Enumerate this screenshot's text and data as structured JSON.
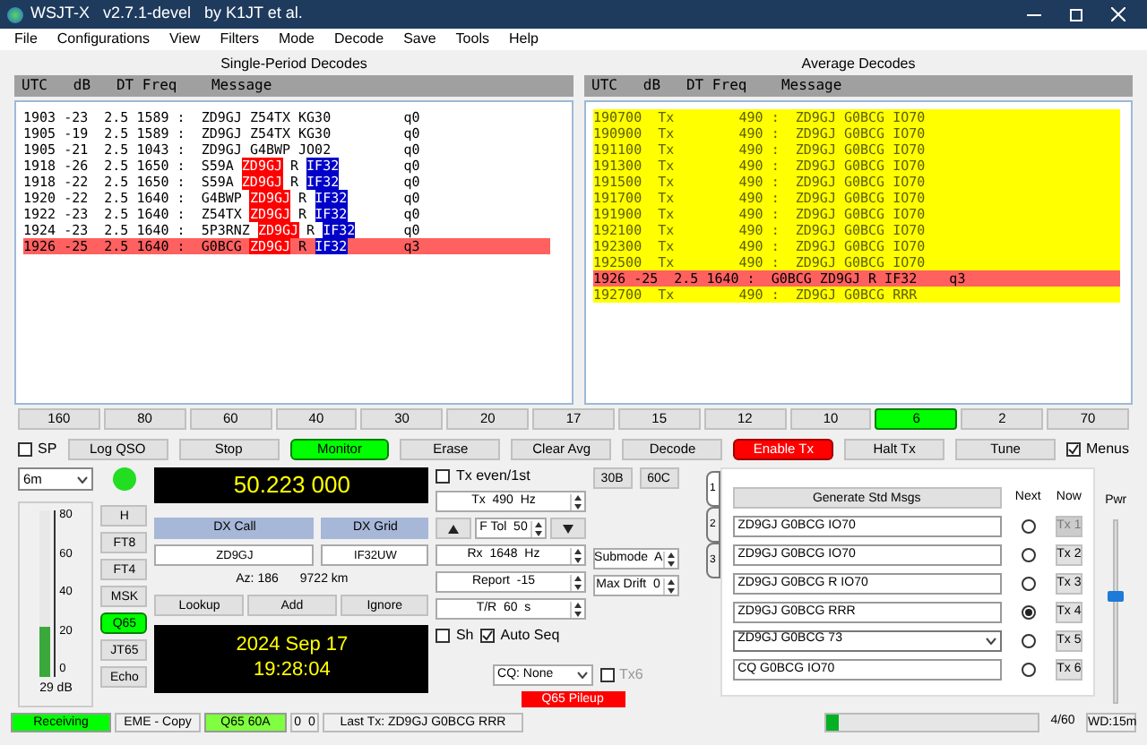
{
  "window": {
    "title": "WSJT-X   v2.7.1-devel   by K1JT et al."
  },
  "menu": [
    "File",
    "Configurations",
    "View",
    "Filters",
    "Mode",
    "Decode",
    "Save",
    "Tools",
    "Help"
  ],
  "single_period": {
    "title": "Single-Period Decodes",
    "header": "UTC   dB   DT Freq    Message",
    "rows": [
      {
        "utc": "1903",
        "db": "-23",
        "dt": "2.5",
        "freq": "1589",
        "sep": ":",
        "words": [
          {
            "text": "ZD9GJ",
            "kind": "plain"
          },
          {
            "text": "Z54TX",
            "kind": "plain"
          },
          {
            "text": "KG30",
            "kind": "plain"
          }
        ],
        "q": "q0",
        "highlight": false
      },
      {
        "utc": "1905",
        "db": "-19",
        "dt": "2.5",
        "freq": "1589",
        "sep": ":",
        "words": [
          {
            "text": "ZD9GJ",
            "kind": "plain"
          },
          {
            "text": "Z54TX",
            "kind": "plain"
          },
          {
            "text": "KG30",
            "kind": "plain"
          }
        ],
        "q": "q0",
        "highlight": false
      },
      {
        "utc": "1905",
        "db": "-21",
        "dt": "2.5",
        "freq": "1043",
        "sep": ":",
        "words": [
          {
            "text": "ZD9GJ",
            "kind": "plain"
          },
          {
            "text": "G4BWP",
            "kind": "plain"
          },
          {
            "text": "JO02",
            "kind": "plain"
          }
        ],
        "q": "q0",
        "highlight": false
      },
      {
        "utc": "1918",
        "db": "-26",
        "dt": "2.5",
        "freq": "1650",
        "sep": ":",
        "words": [
          {
            "text": "S59A",
            "kind": "plain"
          },
          {
            "text": "ZD9GJ",
            "kind": "mycall"
          },
          {
            "text": "R",
            "kind": "plain"
          },
          {
            "text": "IF32",
            "kind": "grid"
          }
        ],
        "q": "q0",
        "highlight": false
      },
      {
        "utc": "1918",
        "db": "-22",
        "dt": "2.5",
        "freq": "1650",
        "sep": ":",
        "words": [
          {
            "text": "S59A",
            "kind": "plain"
          },
          {
            "text": "ZD9GJ",
            "kind": "mycall"
          },
          {
            "text": "R",
            "kind": "plain"
          },
          {
            "text": "IF32",
            "kind": "grid"
          }
        ],
        "q": "q0",
        "highlight": false
      },
      {
        "utc": "1920",
        "db": "-22",
        "dt": "2.5",
        "freq": "1640",
        "sep": ":",
        "words": [
          {
            "text": "G4BWP",
            "kind": "plain"
          },
          {
            "text": "ZD9GJ",
            "kind": "mycall"
          },
          {
            "text": "R",
            "kind": "plain"
          },
          {
            "text": "IF32",
            "kind": "grid"
          }
        ],
        "q": "q0",
        "highlight": false
      },
      {
        "utc": "1922",
        "db": "-23",
        "dt": "2.5",
        "freq": "1640",
        "sep": ":",
        "words": [
          {
            "text": "Z54TX",
            "kind": "plain"
          },
          {
            "text": "ZD9GJ",
            "kind": "mycall"
          },
          {
            "text": "R",
            "kind": "plain"
          },
          {
            "text": "IF32",
            "kind": "grid"
          }
        ],
        "q": "q0",
        "highlight": false
      },
      {
        "utc": "1924",
        "db": "-23",
        "dt": "2.5",
        "freq": "1640",
        "sep": ":",
        "words": [
          {
            "text": "5P3RNZ",
            "kind": "plain"
          },
          {
            "text": "ZD9GJ",
            "kind": "mycall"
          },
          {
            "text": "R",
            "kind": "plain"
          },
          {
            "text": "IF32",
            "kind": "grid"
          }
        ],
        "q": "q0",
        "highlight": false
      },
      {
        "utc": "1926",
        "db": "-25",
        "dt": "2.5",
        "freq": "1640",
        "sep": ":",
        "words": [
          {
            "text": "G0BCG",
            "kind": "plain"
          },
          {
            "text": "ZD9GJ",
            "kind": "mycall"
          },
          {
            "text": "R",
            "kind": "plain"
          },
          {
            "text": "IF32",
            "kind": "grid"
          }
        ],
        "q": "q3",
        "highlight": true
      }
    ]
  },
  "average": {
    "title": "Average Decodes",
    "header": "UTC   dB   DT Freq    Message",
    "rows": [
      {
        "kind": "tx",
        "text": "190700  Tx        490 :  ZD9GJ G0BCG IO70"
      },
      {
        "kind": "tx",
        "text": "190900  Tx        490 :  ZD9GJ G0BCG IO70"
      },
      {
        "kind": "tx",
        "text": "191100  Tx        490 :  ZD9GJ G0BCG IO70"
      },
      {
        "kind": "tx",
        "text": "191300  Tx        490 :  ZD9GJ G0BCG IO70"
      },
      {
        "kind": "tx",
        "text": "191500  Tx        490 :  ZD9GJ G0BCG IO70"
      },
      {
        "kind": "tx",
        "text": "191700  Tx        490 :  ZD9GJ G0BCG IO70"
      },
      {
        "kind": "tx",
        "text": "191900  Tx        490 :  ZD9GJ G0BCG IO70"
      },
      {
        "kind": "tx",
        "text": "192100  Tx        490 :  ZD9GJ G0BCG IO70"
      },
      {
        "kind": "tx",
        "text": "192300  Tx        490 :  ZD9GJ G0BCG IO70"
      },
      {
        "kind": "tx",
        "text": "192500  Tx        490 :  ZD9GJ G0BCG IO70"
      },
      {
        "kind": "decode",
        "text": "1926 -25  2.5 1640 :  G0BCG ZD9GJ R IF32    q3"
      },
      {
        "kind": "tx",
        "text": "192700  Tx        490 :  ZD9GJ G0BCG RRR"
      }
    ]
  },
  "bands": [
    {
      "label": "160",
      "selected": false
    },
    {
      "label": "80",
      "selected": false
    },
    {
      "label": "60",
      "selected": false
    },
    {
      "label": "40",
      "selected": false
    },
    {
      "label": "30",
      "selected": false
    },
    {
      "label": "20",
      "selected": false
    },
    {
      "label": "17",
      "selected": false
    },
    {
      "label": "15",
      "selected": false
    },
    {
      "label": "12",
      "selected": false
    },
    {
      "label": "10",
      "selected": false
    },
    {
      "label": "6",
      "selected": true
    },
    {
      "label": "2",
      "selected": false
    },
    {
      "label": "70",
      "selected": false
    }
  ],
  "controls": [
    {
      "kind": "checkbox",
      "label": "SP",
      "checked": false
    },
    {
      "kind": "button",
      "label": "Log QSO"
    },
    {
      "kind": "button",
      "label": "Stop"
    },
    {
      "kind": "monitor",
      "label": "Monitor",
      "on": true
    },
    {
      "kind": "button",
      "label": "Erase"
    },
    {
      "kind": "button",
      "label": "Clear Avg"
    },
    {
      "kind": "button",
      "label": "Decode"
    },
    {
      "kind": "enable_tx",
      "label": "Enable Tx",
      "on": true
    },
    {
      "kind": "button",
      "label": "Halt Tx"
    },
    {
      "kind": "button",
      "label": "Tune"
    },
    {
      "kind": "checkbox",
      "label": "Menus",
      "checked": true
    }
  ],
  "band_select": {
    "value": "6m"
  },
  "frequency": "50.223 000",
  "meter": {
    "ticks": [
      "80",
      "60",
      "40",
      "20",
      "0"
    ],
    "level": 0.3,
    "reading": "29 dB"
  },
  "modes": [
    {
      "label": "H",
      "selected": false
    },
    {
      "label": "FT8",
      "selected": false
    },
    {
      "label": "FT4",
      "selected": false
    },
    {
      "label": "MSK",
      "selected": false
    },
    {
      "label": "Q65",
      "selected": true
    },
    {
      "label": "JT65",
      "selected": false
    },
    {
      "label": "Echo",
      "selected": false
    }
  ],
  "dx": {
    "call_label": "DX Call",
    "grid_label": "DX Grid",
    "call": "ZD9GJ",
    "grid": "IF32UW",
    "az": "Az: 186",
    "distance": "9722 km",
    "buttons": [
      "Lookup",
      "Add",
      "Ignore"
    ]
  },
  "clock": {
    "date": "2024 Sep 17",
    "time": "19:28:04"
  },
  "settings": {
    "tx_even": {
      "label": "Tx even/1st",
      "checked": false
    },
    "tx_freq": "Tx  490  Hz",
    "ftol": "F Tol  50",
    "rx_freq": "Rx  1648  Hz",
    "report": "Report  -15",
    "tr": "T/R  60  s",
    "sh": {
      "label": "Sh",
      "checked": false
    },
    "auto_seq": {
      "label": "Auto Seq",
      "checked": true
    },
    "cq": "CQ: None",
    "tx6": {
      "label": "Tx6",
      "checked": false
    },
    "pileup": "Q65 Pileup"
  },
  "submode_buttons": [
    "30B",
    "60C"
  ],
  "submode": "Submode  A",
  "max_drift": "Max Drift  0",
  "tabs": [
    {
      "label": "1",
      "selected": true
    },
    {
      "label": "2",
      "selected": false
    },
    {
      "label": "3",
      "selected": false
    }
  ],
  "messages": {
    "generate": "Generate Std Msgs",
    "next_label": "Next",
    "now_label": "Now",
    "rows": [
      {
        "kind": "field",
        "text": "ZD9GJ G0BCG IO70",
        "next": false,
        "button": "Tx 1",
        "disabled": true
      },
      {
        "kind": "field",
        "text": "ZD9GJ G0BCG IO70",
        "next": false,
        "button": "Tx 2",
        "disabled": false
      },
      {
        "kind": "field",
        "text": "ZD9GJ G0BCG R IO70",
        "next": false,
        "button": "Tx 3",
        "disabled": false
      },
      {
        "kind": "field",
        "text": "ZD9GJ G0BCG RRR",
        "next": true,
        "button": "Tx 4",
        "disabled": false
      },
      {
        "kind": "dropdown",
        "text": "ZD9GJ G0BCG 73",
        "next": false,
        "button": "Tx 5",
        "disabled": false
      },
      {
        "kind": "field",
        "text": "CQ G0BCG IO70",
        "next": false,
        "button": "Tx 6",
        "disabled": false
      }
    ]
  },
  "power": {
    "label": "Pwr",
    "level": 0.55
  },
  "status_bar": {
    "state": "Receiving",
    "mode_info": "EME - Copy",
    "mode": "Q65 60A",
    "counts": "0  0",
    "last_tx": "Last Tx: ZD9GJ G0BCG RRR",
    "progress": {
      "level": 0.06
    },
    "period": "4/60",
    "wd": "WD:15m"
  }
}
